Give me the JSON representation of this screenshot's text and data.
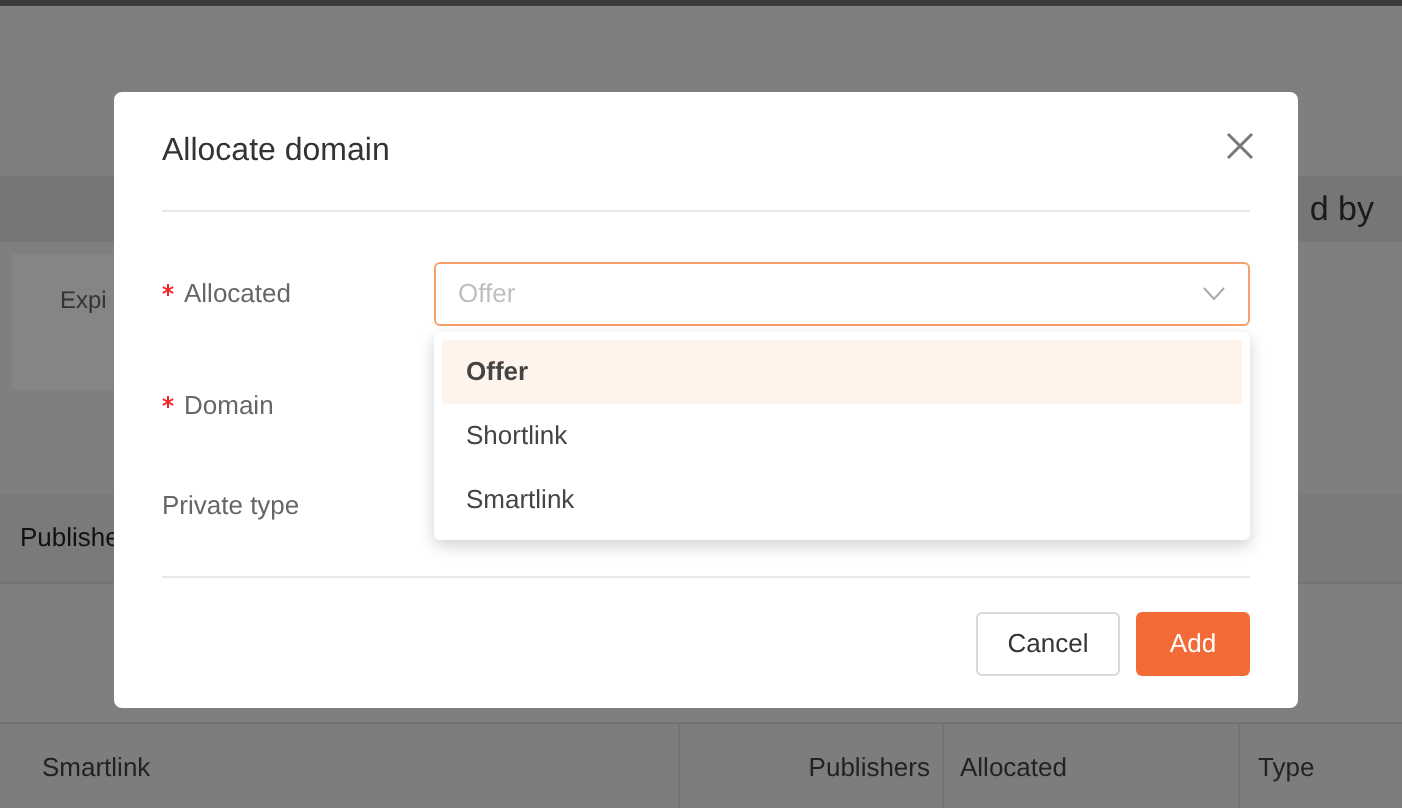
{
  "background": {
    "header_fragment": "d by",
    "card": {
      "label": "Expi"
    },
    "table_header_fragment": "Publishe",
    "bottom_table": {
      "columns": [
        "Smartlink",
        "Publishers",
        "Allocated",
        "Type"
      ]
    }
  },
  "dialog": {
    "title": "Allocate domain",
    "fields": [
      {
        "kind": "select",
        "label": "Allocated",
        "required": true,
        "placeholder": "Offer",
        "focused": true
      },
      {
        "kind": "hidden",
        "label": "Domain",
        "required": true
      },
      {
        "kind": "hidden",
        "label": "Private type",
        "required": false
      }
    ],
    "dropdown": [
      {
        "label": "Offer",
        "selected": true
      },
      {
        "label": "Shortlink",
        "selected": false
      },
      {
        "label": "Smartlink",
        "selected": false
      }
    ],
    "buttons": [
      {
        "label": "Cancel",
        "kind": "secondary"
      },
      {
        "label": "Add",
        "kind": "primary"
      }
    ]
  }
}
